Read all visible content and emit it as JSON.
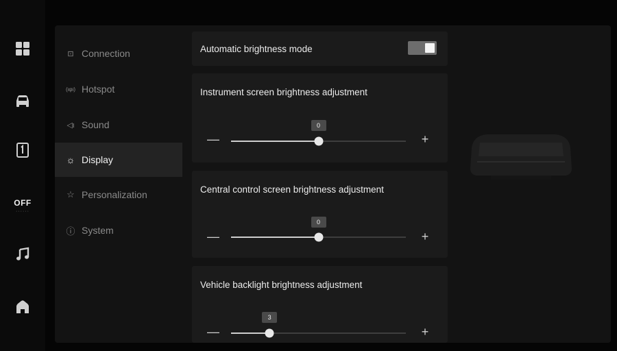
{
  "rail": {
    "off_label": "OFF",
    "fan_dots": "······",
    "items": [
      {
        "icon": "apps-grid-icon"
      },
      {
        "icon": "car-icon"
      },
      {
        "icon": "phone-icon"
      },
      {
        "icon": "fan-off-indicator"
      },
      {
        "icon": "music-note-icon"
      },
      {
        "icon": "home-icon"
      }
    ]
  },
  "nav": {
    "items": [
      {
        "label": "Connection",
        "icon": "connection-icon",
        "glyph": "⊡",
        "active": false
      },
      {
        "label": "Hotspot",
        "icon": "hotspot-icon",
        "glyph": "(ιφι)",
        "active": false
      },
      {
        "label": "Sound",
        "icon": "speaker-icon",
        "glyph": "◁ι",
        "active": false
      },
      {
        "label": "Display",
        "icon": "sun-icon",
        "glyph": "☼",
        "active": true
      },
      {
        "label": "Personalization",
        "icon": "personalization-icon",
        "glyph": "☆",
        "active": false
      },
      {
        "label": "System",
        "icon": "info-icon",
        "glyph": "ⓘ",
        "active": false
      }
    ]
  },
  "auto_brightness": {
    "label": "Automatic brightness mode",
    "enabled": true
  },
  "sliders": [
    {
      "label": "Instrument screen brightness adjustment",
      "value": "0",
      "fraction": 0.5,
      "minus": "—",
      "plus": "+"
    },
    {
      "label": "Central control screen brightness adjustment",
      "value": "0",
      "fraction": 0.5,
      "minus": "—",
      "plus": "+"
    },
    {
      "label": "Vehicle backlight brightness adjustment",
      "value": "3",
      "fraction": 0.22,
      "minus": "—",
      "plus": "+"
    }
  ],
  "colors": {
    "panel": "#131313",
    "card": "#1b1b1b",
    "active_nav": "#232323",
    "accent": "#e8e8e8"
  }
}
